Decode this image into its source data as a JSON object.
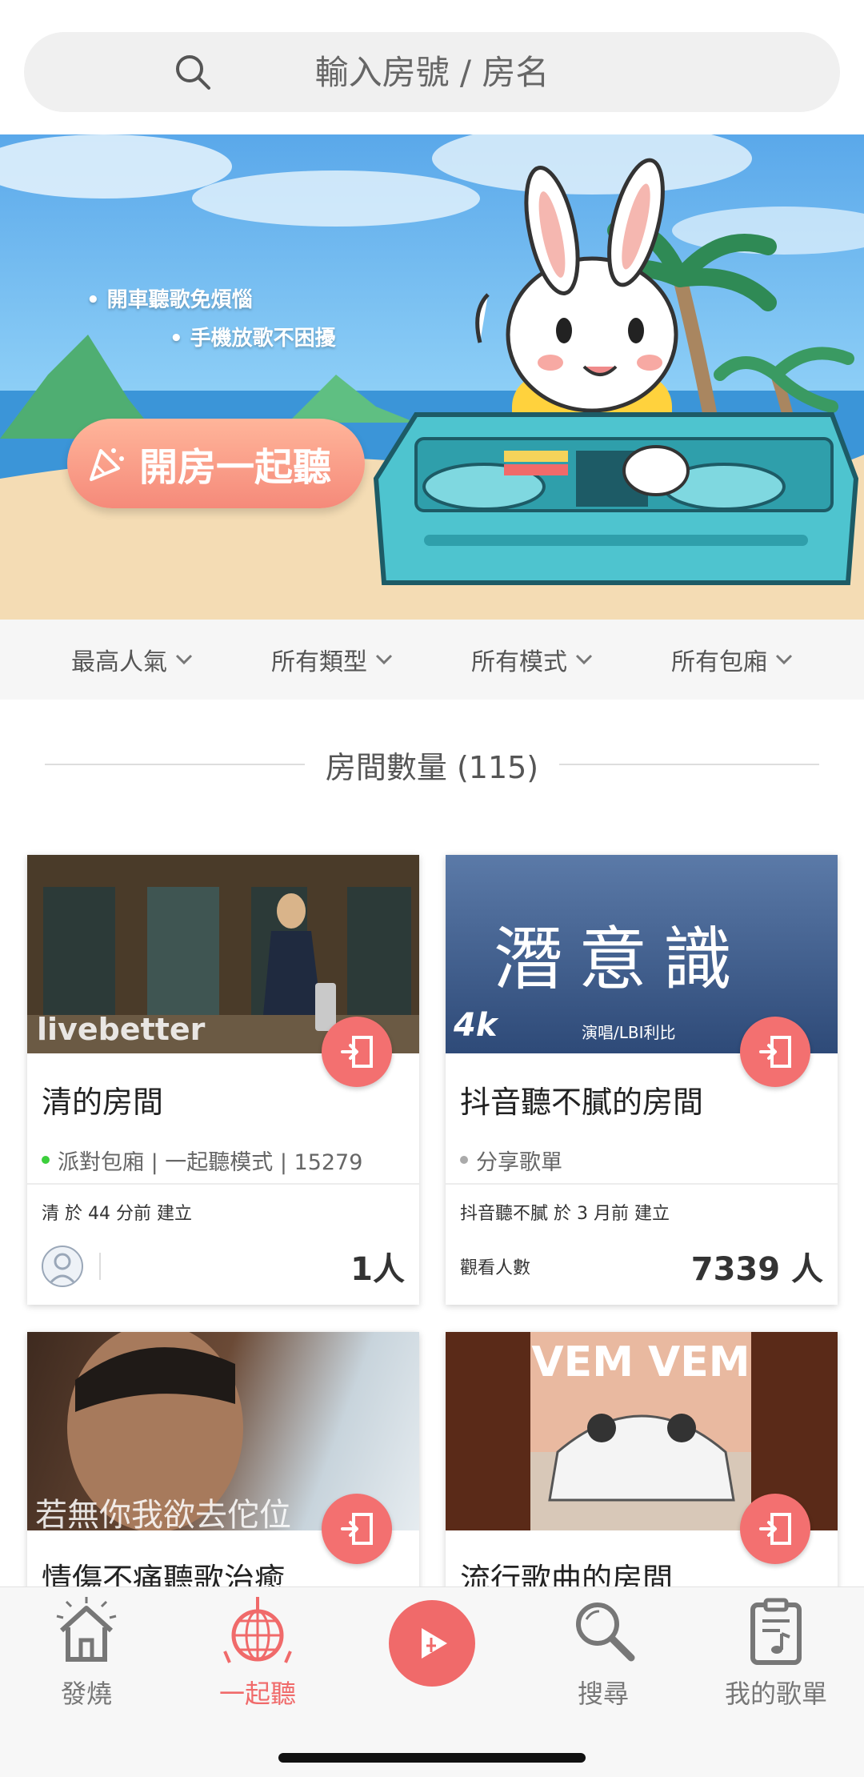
{
  "search": {
    "placeholder": "輸入房號 / 房名"
  },
  "banner": {
    "bullet1": "• 開車聽歌免煩惱",
    "bullet2": "• 手機放歌不困擾",
    "cta": "開房一起聽"
  },
  "filters": [
    {
      "label": "最高人氣"
    },
    {
      "label": "所有類型"
    },
    {
      "label": "所有模式"
    },
    {
      "label": "所有包廂"
    }
  ],
  "section": {
    "title": "房間數量 (115)"
  },
  "rooms": [
    {
      "thumb_text": "livebetter",
      "title": "清的房間",
      "status_color": "#3ccf3c",
      "meta": "派對包廂 | 一起聽模式 | 15279",
      "created": "清 於 44 分前 建立",
      "viewer_label": "",
      "count": "1人"
    },
    {
      "thumb_text": "潛意識",
      "thumb_sub": "演唱/LBI利比",
      "thumb_brand": "4k",
      "title": "抖音聽不膩的房間",
      "status_color": "#aaaaaa",
      "meta": "分享歌單",
      "created": "抖音聽不膩 於 3 月前 建立",
      "viewer_label": "觀看人數",
      "count": "7339 人"
    },
    {
      "thumb_text": "若無你我欲去佗位",
      "title": "情傷不痛聽歌治癒"
    },
    {
      "thumb_text": "VEM VEM",
      "title": "流行歌曲的房間"
    }
  ],
  "nav": [
    {
      "label": "發燒",
      "icon": "home-icon"
    },
    {
      "label": "一起聽",
      "icon": "disco-ball-icon",
      "active": true
    },
    {
      "label": "",
      "icon": "play-icon"
    },
    {
      "label": "搜尋",
      "icon": "search-icon"
    },
    {
      "label": "我的歌單",
      "icon": "playlist-icon"
    }
  ],
  "colors": {
    "accent": "#f06a6a",
    "join": "#f37070"
  }
}
